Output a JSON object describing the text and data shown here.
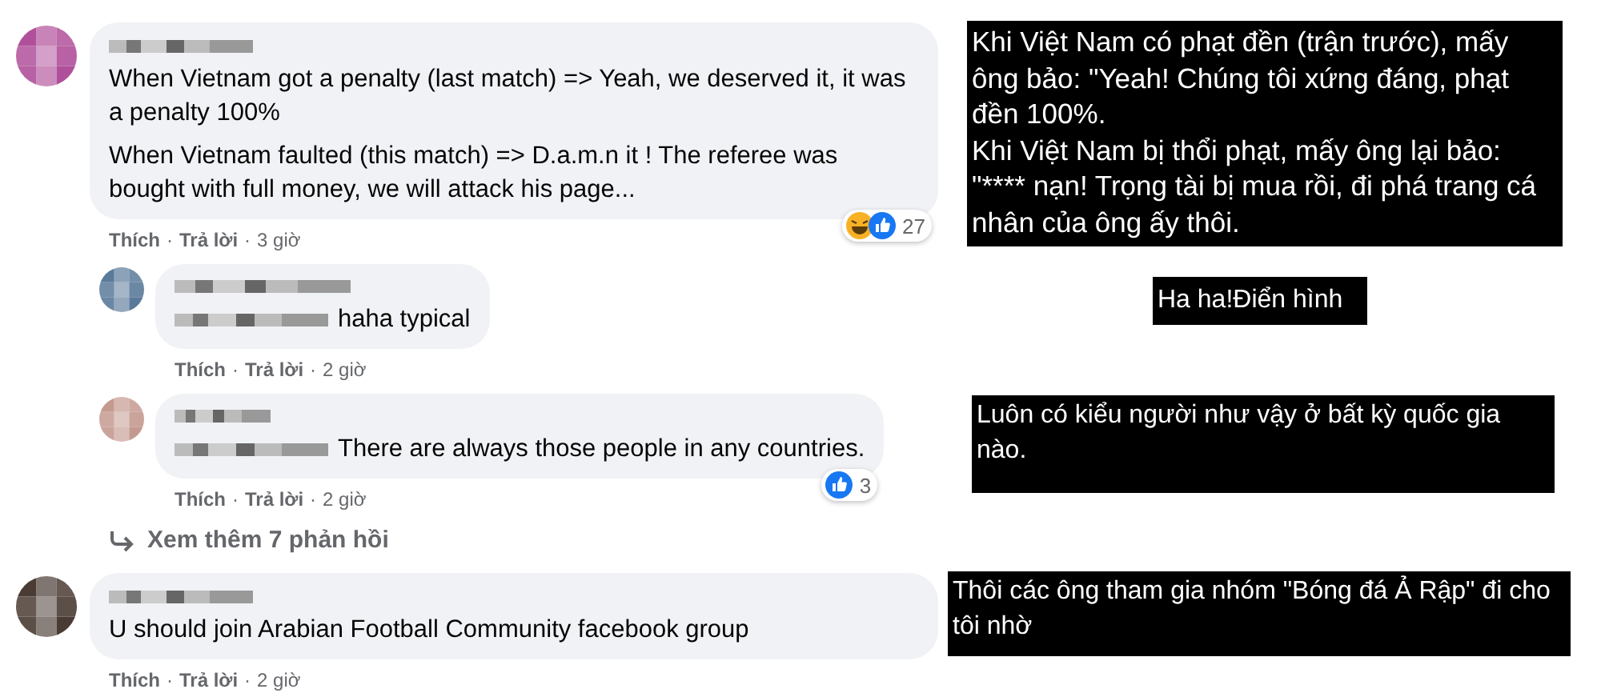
{
  "comments": [
    {
      "paragraphs": [
        "When Vietnam got a penalty (last match) => Yeah, we deserved it, it was a penalty 100%",
        "When Vietnam faulted (this match) => D.a.m.n it ! The referee was bought with full money, we will attack his page..."
      ],
      "reactions": {
        "haha": true,
        "like": true,
        "count": "27"
      },
      "actions": [
        {
          "kind": "link",
          "label": "Thích"
        },
        {
          "kind": "sep",
          "label": "·"
        },
        {
          "kind": "link",
          "label": "Trả lời"
        },
        {
          "kind": "sep",
          "label": "·"
        },
        {
          "kind": "time",
          "label": "3 giờ"
        }
      ],
      "replies": [
        {
          "mention": true,
          "paragraphs": [
            "haha typical"
          ],
          "actions": [
            {
              "kind": "link",
              "label": "Thích"
            },
            {
              "kind": "sep",
              "label": "·"
            },
            {
              "kind": "link",
              "label": "Trả lời"
            },
            {
              "kind": "sep",
              "label": "·"
            },
            {
              "kind": "time",
              "label": "2 giờ"
            }
          ]
        },
        {
          "mention": true,
          "paragraphs": [
            "There are always those people in any countries."
          ],
          "reactions": {
            "like": true,
            "count": "3"
          },
          "actions": [
            {
              "kind": "link",
              "label": "Thích"
            },
            {
              "kind": "sep",
              "label": "·"
            },
            {
              "kind": "link",
              "label": "Trả lời"
            },
            {
              "kind": "sep",
              "label": "·"
            },
            {
              "kind": "time",
              "label": "2 giờ"
            }
          ]
        }
      ],
      "more_replies": "Xem thêm 7 phản hồi"
    },
    {
      "paragraphs": [
        "U should join Arabian Football Community facebook group"
      ],
      "actions": [
        {
          "kind": "link",
          "label": "Thích"
        },
        {
          "kind": "sep",
          "label": "·"
        },
        {
          "kind": "link",
          "label": "Trả lời"
        },
        {
          "kind": "sep",
          "label": "·"
        },
        {
          "kind": "time",
          "label": "2 giờ"
        }
      ]
    }
  ],
  "translations": [
    {
      "lines": [
        "Khi Việt Nam có phạt đền (trận trước), mấy ông bảo: \"Yeah! Chúng tôi xứng đáng, phạt đền 100%.",
        "Khi Việt Nam bị thổi phạt, mấy ông lại bảo: \"**** nạn! Trọng tài bị mua rồi, đi phá trang cá nhân của  ông ấy thôi."
      ]
    },
    {
      "lines": [
        "Ha ha!Điển hình"
      ]
    },
    {
      "lines": [
        "Luôn có kiểu người như vậy ở bất kỳ quốc gia nào."
      ]
    },
    {
      "lines": [
        "Thôi các ông tham gia nhóm \"Bóng đá Ả Rập\" đi cho tôi nhờ"
      ]
    }
  ]
}
